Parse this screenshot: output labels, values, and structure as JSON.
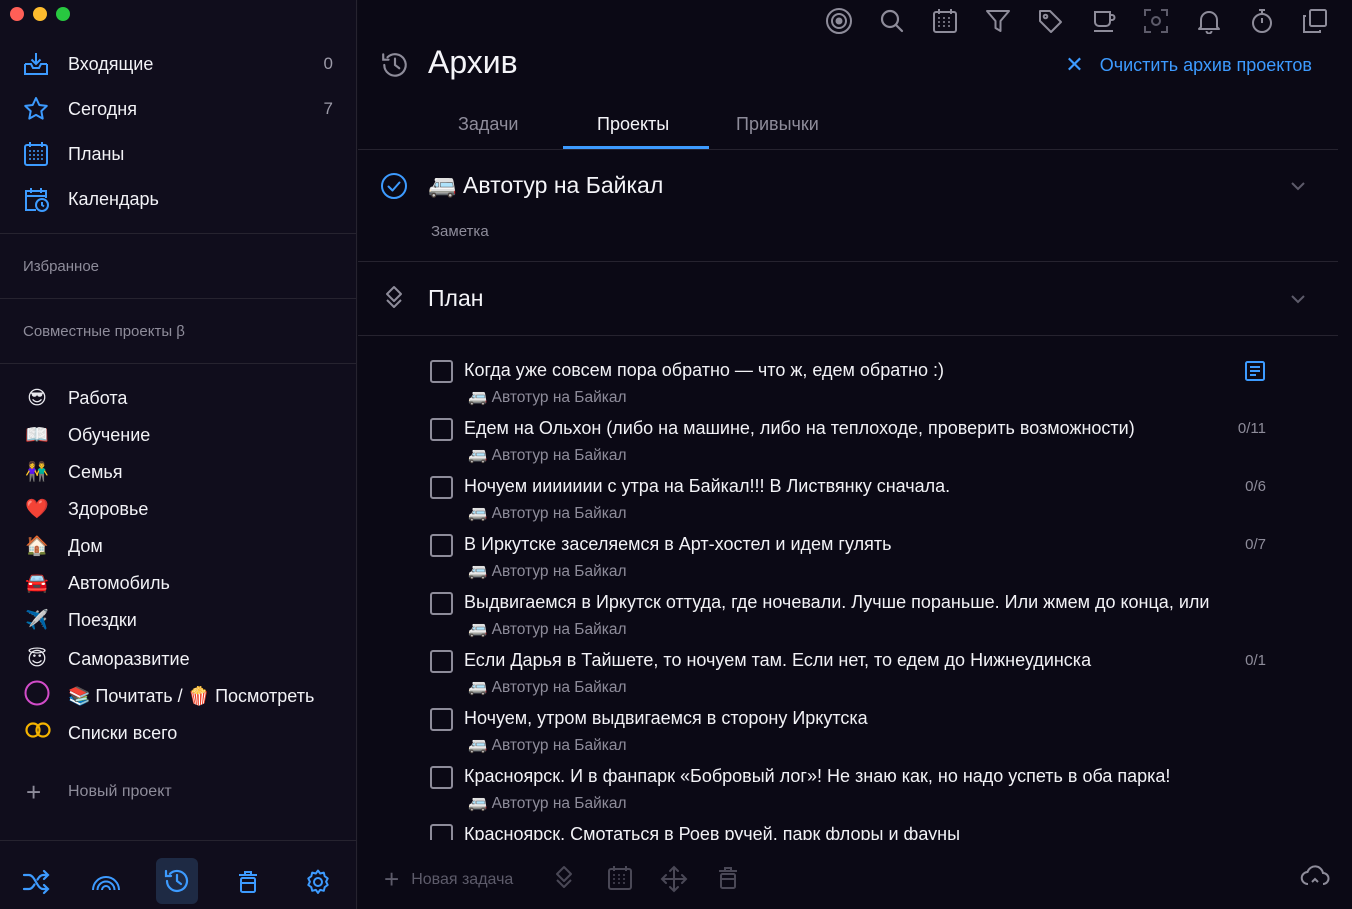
{
  "sidebar": {
    "nav": [
      {
        "label": "Входящие",
        "count": "0",
        "icon": "inbox-icon"
      },
      {
        "label": "Сегодня",
        "count": "7",
        "icon": "star-icon"
      },
      {
        "label": "Планы",
        "count": "",
        "icon": "calendar-grid-icon"
      },
      {
        "label": "Календарь",
        "count": "",
        "icon": "calendar-clock-icon"
      }
    ],
    "favorites_title": "Избранное",
    "shared_title": "Совместные проекты β",
    "projects": [
      {
        "emoji": "😎",
        "label": "Работа"
      },
      {
        "emoji": "📖",
        "label": "Обучение"
      },
      {
        "emoji": "👫",
        "label": "Семья"
      },
      {
        "emoji": "❤️",
        "label": "Здоровье"
      },
      {
        "emoji": "🏠",
        "label": "Дом"
      },
      {
        "emoji": "🚘",
        "label": "Автомобиль"
      },
      {
        "emoji": "✈️",
        "label": "Поездки"
      },
      {
        "emoji": "😇",
        "label": "Саморазвитие"
      },
      {
        "emoji": "",
        "label": "📚 Почитать / 🍿 Посмотреть"
      },
      {
        "emoji": "",
        "label": "Списки всего"
      }
    ],
    "new_project": "Новый проект",
    "bottom_icons": [
      "shuffle-icon",
      "rainbow-icon",
      "history-icon",
      "trash-icon",
      "settings-icon"
    ]
  },
  "toolbar": {
    "icons": [
      "focus-icon",
      "search-icon",
      "calendar-icon",
      "filter-icon",
      "tag-icon",
      "coffee-icon",
      "scan-icon",
      "bell-icon",
      "timer-icon",
      "copy-icon"
    ]
  },
  "header": {
    "title": "Архив",
    "clear_label": "Очистить архив проектов"
  },
  "tabs": [
    "Задачи",
    "Проекты",
    "Привычки"
  ],
  "project": {
    "name": "🚐 Автотур на Байкал",
    "note": "Заметка"
  },
  "plan": {
    "title": "План"
  },
  "tasks": [
    {
      "title": "Когда уже совсем пора обратно — что ж, едем обратно :)",
      "sub": "🚐 Автотур на Байкал",
      "count": "",
      "has_note": true
    },
    {
      "title": "Едем на Ольхон (либо на машине, либо на теплоходе, проверить возможности)",
      "sub": "🚐 Автотур на Байкал",
      "count": "0/11",
      "has_note": false
    },
    {
      "title": "Ночуем иииииии с утра на Байкал!!! В Листвянку сначала.",
      "sub": "🚐 Автотур на Байкал",
      "count": "0/6",
      "has_note": false
    },
    {
      "title": "В Иркутске заселяемся в Арт-хостел и идем гулять",
      "sub": "🚐 Автотур на Байкал",
      "count": "0/7",
      "has_note": false
    },
    {
      "title": "Выдвигаемся в Иркутск оттуда, где ночевали. Лучше пораньше. Или жмем до конца, или",
      "sub": "🚐 Автотур на Байкал",
      "count": "",
      "has_note": false
    },
    {
      "title": "Если Дарья в Тайшете, то ночуем там. Если нет, то едем до Нижнеудинска",
      "sub": "🚐 Автотур на Байкал",
      "count": "0/1",
      "has_note": false
    },
    {
      "title": "Ночуем, утром выдвигаемся в сторону Иркутска",
      "sub": "🚐 Автотур на Байкал",
      "count": "",
      "has_note": false
    },
    {
      "title": "Красноярск. И в фанпарк «Бобровый лог»! Не знаю как, но надо успеть в оба парка!",
      "sub": "🚐 Автотур на Байкал",
      "count": "",
      "has_note": false
    },
    {
      "title": "Красноярск. Смотаться в Роев ручей, парк флоры и фауны",
      "sub": "",
      "count": "",
      "has_note": false
    }
  ],
  "footer": {
    "new_task": "Новая задача",
    "icons": [
      "priority-icon",
      "calendar-icon",
      "move-icon",
      "trash-icon",
      "cloud-sync-icon"
    ]
  },
  "colors": {
    "accent": "#3d9bff",
    "background": "#0b0915",
    "sidebar": "#100d1c"
  }
}
